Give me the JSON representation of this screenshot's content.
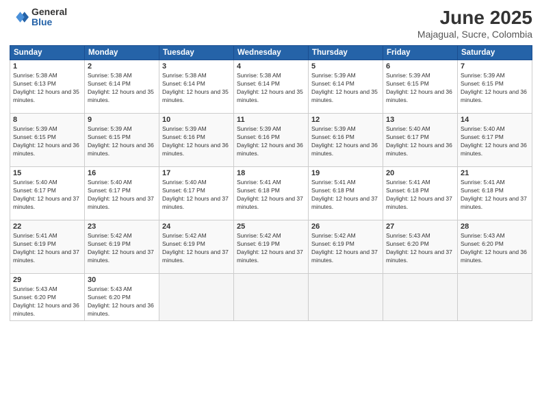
{
  "header": {
    "logo_general": "General",
    "logo_blue": "Blue",
    "month_year": "June 2025",
    "location": "Majagual, Sucre, Colombia"
  },
  "days_of_week": [
    "Sunday",
    "Monday",
    "Tuesday",
    "Wednesday",
    "Thursday",
    "Friday",
    "Saturday"
  ],
  "weeks": [
    [
      {
        "day": "1",
        "sunrise": "5:38 AM",
        "sunset": "6:13 PM",
        "daylight": "12 hours and 35 minutes."
      },
      {
        "day": "2",
        "sunrise": "5:38 AM",
        "sunset": "6:14 PM",
        "daylight": "12 hours and 35 minutes."
      },
      {
        "day": "3",
        "sunrise": "5:38 AM",
        "sunset": "6:14 PM",
        "daylight": "12 hours and 35 minutes."
      },
      {
        "day": "4",
        "sunrise": "5:38 AM",
        "sunset": "6:14 PM",
        "daylight": "12 hours and 35 minutes."
      },
      {
        "day": "5",
        "sunrise": "5:39 AM",
        "sunset": "6:14 PM",
        "daylight": "12 hours and 35 minutes."
      },
      {
        "day": "6",
        "sunrise": "5:39 AM",
        "sunset": "6:15 PM",
        "daylight": "12 hours and 36 minutes."
      },
      {
        "day": "7",
        "sunrise": "5:39 AM",
        "sunset": "6:15 PM",
        "daylight": "12 hours and 36 minutes."
      }
    ],
    [
      {
        "day": "8",
        "sunrise": "5:39 AM",
        "sunset": "6:15 PM",
        "daylight": "12 hours and 36 minutes."
      },
      {
        "day": "9",
        "sunrise": "5:39 AM",
        "sunset": "6:15 PM",
        "daylight": "12 hours and 36 minutes."
      },
      {
        "day": "10",
        "sunrise": "5:39 AM",
        "sunset": "6:16 PM",
        "daylight": "12 hours and 36 minutes."
      },
      {
        "day": "11",
        "sunrise": "5:39 AM",
        "sunset": "6:16 PM",
        "daylight": "12 hours and 36 minutes."
      },
      {
        "day": "12",
        "sunrise": "5:39 AM",
        "sunset": "6:16 PM",
        "daylight": "12 hours and 36 minutes."
      },
      {
        "day": "13",
        "sunrise": "5:40 AM",
        "sunset": "6:17 PM",
        "daylight": "12 hours and 36 minutes."
      },
      {
        "day": "14",
        "sunrise": "5:40 AM",
        "sunset": "6:17 PM",
        "daylight": "12 hours and 36 minutes."
      }
    ],
    [
      {
        "day": "15",
        "sunrise": "5:40 AM",
        "sunset": "6:17 PM",
        "daylight": "12 hours and 37 minutes."
      },
      {
        "day": "16",
        "sunrise": "5:40 AM",
        "sunset": "6:17 PM",
        "daylight": "12 hours and 37 minutes."
      },
      {
        "day": "17",
        "sunrise": "5:40 AM",
        "sunset": "6:17 PM",
        "daylight": "12 hours and 37 minutes."
      },
      {
        "day": "18",
        "sunrise": "5:41 AM",
        "sunset": "6:18 PM",
        "daylight": "12 hours and 37 minutes."
      },
      {
        "day": "19",
        "sunrise": "5:41 AM",
        "sunset": "6:18 PM",
        "daylight": "12 hours and 37 minutes."
      },
      {
        "day": "20",
        "sunrise": "5:41 AM",
        "sunset": "6:18 PM",
        "daylight": "12 hours and 37 minutes."
      },
      {
        "day": "21",
        "sunrise": "5:41 AM",
        "sunset": "6:18 PM",
        "daylight": "12 hours and 37 minutes."
      }
    ],
    [
      {
        "day": "22",
        "sunrise": "5:41 AM",
        "sunset": "6:19 PM",
        "daylight": "12 hours and 37 minutes."
      },
      {
        "day": "23",
        "sunrise": "5:42 AM",
        "sunset": "6:19 PM",
        "daylight": "12 hours and 37 minutes."
      },
      {
        "day": "24",
        "sunrise": "5:42 AM",
        "sunset": "6:19 PM",
        "daylight": "12 hours and 37 minutes."
      },
      {
        "day": "25",
        "sunrise": "5:42 AM",
        "sunset": "6:19 PM",
        "daylight": "12 hours and 37 minutes."
      },
      {
        "day": "26",
        "sunrise": "5:42 AM",
        "sunset": "6:19 PM",
        "daylight": "12 hours and 37 minutes."
      },
      {
        "day": "27",
        "sunrise": "5:43 AM",
        "sunset": "6:20 PM",
        "daylight": "12 hours and 37 minutes."
      },
      {
        "day": "28",
        "sunrise": "5:43 AM",
        "sunset": "6:20 PM",
        "daylight": "12 hours and 36 minutes."
      }
    ],
    [
      {
        "day": "29",
        "sunrise": "5:43 AM",
        "sunset": "6:20 PM",
        "daylight": "12 hours and 36 minutes."
      },
      {
        "day": "30",
        "sunrise": "5:43 AM",
        "sunset": "6:20 PM",
        "daylight": "12 hours and 36 minutes."
      },
      null,
      null,
      null,
      null,
      null
    ]
  ],
  "labels": {
    "sunrise_prefix": "Sunrise: ",
    "sunset_prefix": "Sunset: ",
    "daylight_prefix": "Daylight: "
  }
}
